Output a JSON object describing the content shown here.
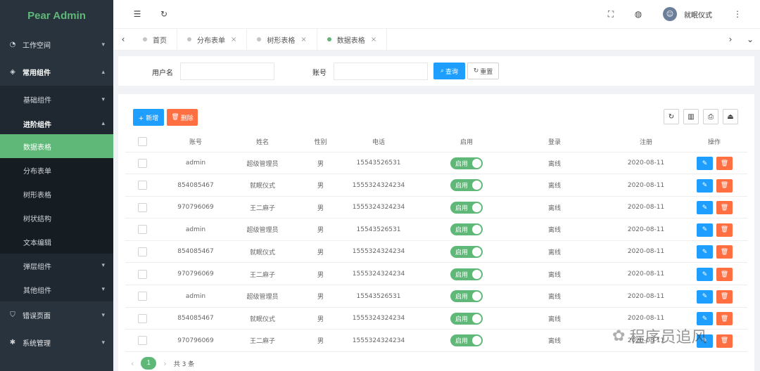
{
  "app": {
    "logo": "Pear Admin"
  },
  "sidebar": {
    "groups": [
      {
        "label": "工作空间",
        "icon": "dashboard-icon",
        "arrow": "⌄"
      },
      {
        "label": "常用组件",
        "icon": "package-icon",
        "arrow": "⌃"
      }
    ],
    "sub": [
      {
        "label": "基础组件",
        "arrow": "⌄"
      },
      {
        "label": "进阶组件",
        "arrow": "⌃"
      }
    ],
    "sub2": [
      {
        "label": "数据表格"
      },
      {
        "label": "分布表单"
      },
      {
        "label": "树形表格"
      },
      {
        "label": "树状结构"
      },
      {
        "label": "文本编辑"
      }
    ],
    "sub_after": [
      {
        "label": "弹层组件",
        "arrow": "⌄"
      },
      {
        "label": "其他组件",
        "arrow": "⌄"
      }
    ],
    "bottom": [
      {
        "label": "错误页面",
        "icon": "shield-icon",
        "arrow": "⌄"
      },
      {
        "label": "系统管理",
        "icon": "gear-icon",
        "arrow": "⌄"
      }
    ]
  },
  "header": {
    "username": "就眠仪式"
  },
  "tabs": [
    {
      "label": "首页",
      "closable": false
    },
    {
      "label": "分布表单",
      "closable": true
    },
    {
      "label": "树形表格",
      "closable": true
    },
    {
      "label": "数据表格",
      "closable": true,
      "active": true
    }
  ],
  "search": {
    "username_label": "用户名",
    "account_label": "账号",
    "query_btn": "查询",
    "reset_btn": "重置"
  },
  "toolbar": {
    "add_btn": "+ 新增",
    "delete_btn": "删除"
  },
  "table": {
    "columns": [
      "账号",
      "姓名",
      "性别",
      "电话",
      "启用",
      "登录",
      "注册",
      "操作"
    ],
    "switch_label": "启用",
    "rows": [
      [
        "admin",
        "超级管理员",
        "男",
        "15543526531",
        "离线",
        "2020-08-11"
      ],
      [
        "854085467",
        "就眠仪式",
        "男",
        "1555324324234",
        "离线",
        "2020-08-11"
      ],
      [
        "970796069",
        "王二麻子",
        "男",
        "1555324324234",
        "离线",
        "2020-08-11"
      ],
      [
        "admin",
        "超级管理员",
        "男",
        "15543526531",
        "离线",
        "2020-08-11"
      ],
      [
        "854085467",
        "就眠仪式",
        "男",
        "1555324324234",
        "离线",
        "2020-08-11"
      ],
      [
        "970796069",
        "王二麻子",
        "男",
        "1555324324234",
        "离线",
        "2020-08-11"
      ],
      [
        "admin",
        "超级管理员",
        "男",
        "15543526531",
        "离线",
        "2020-08-11"
      ],
      [
        "854085467",
        "就眠仪式",
        "男",
        "1555324324234",
        "离线",
        "2020-08-11"
      ],
      [
        "970796069",
        "王二麻子",
        "男",
        "1555324324234",
        "离线",
        "2020-08-11"
      ]
    ]
  },
  "pager": {
    "current": "1",
    "total": "共 3 条"
  },
  "watermark": {
    "text": "程序员追风"
  }
}
